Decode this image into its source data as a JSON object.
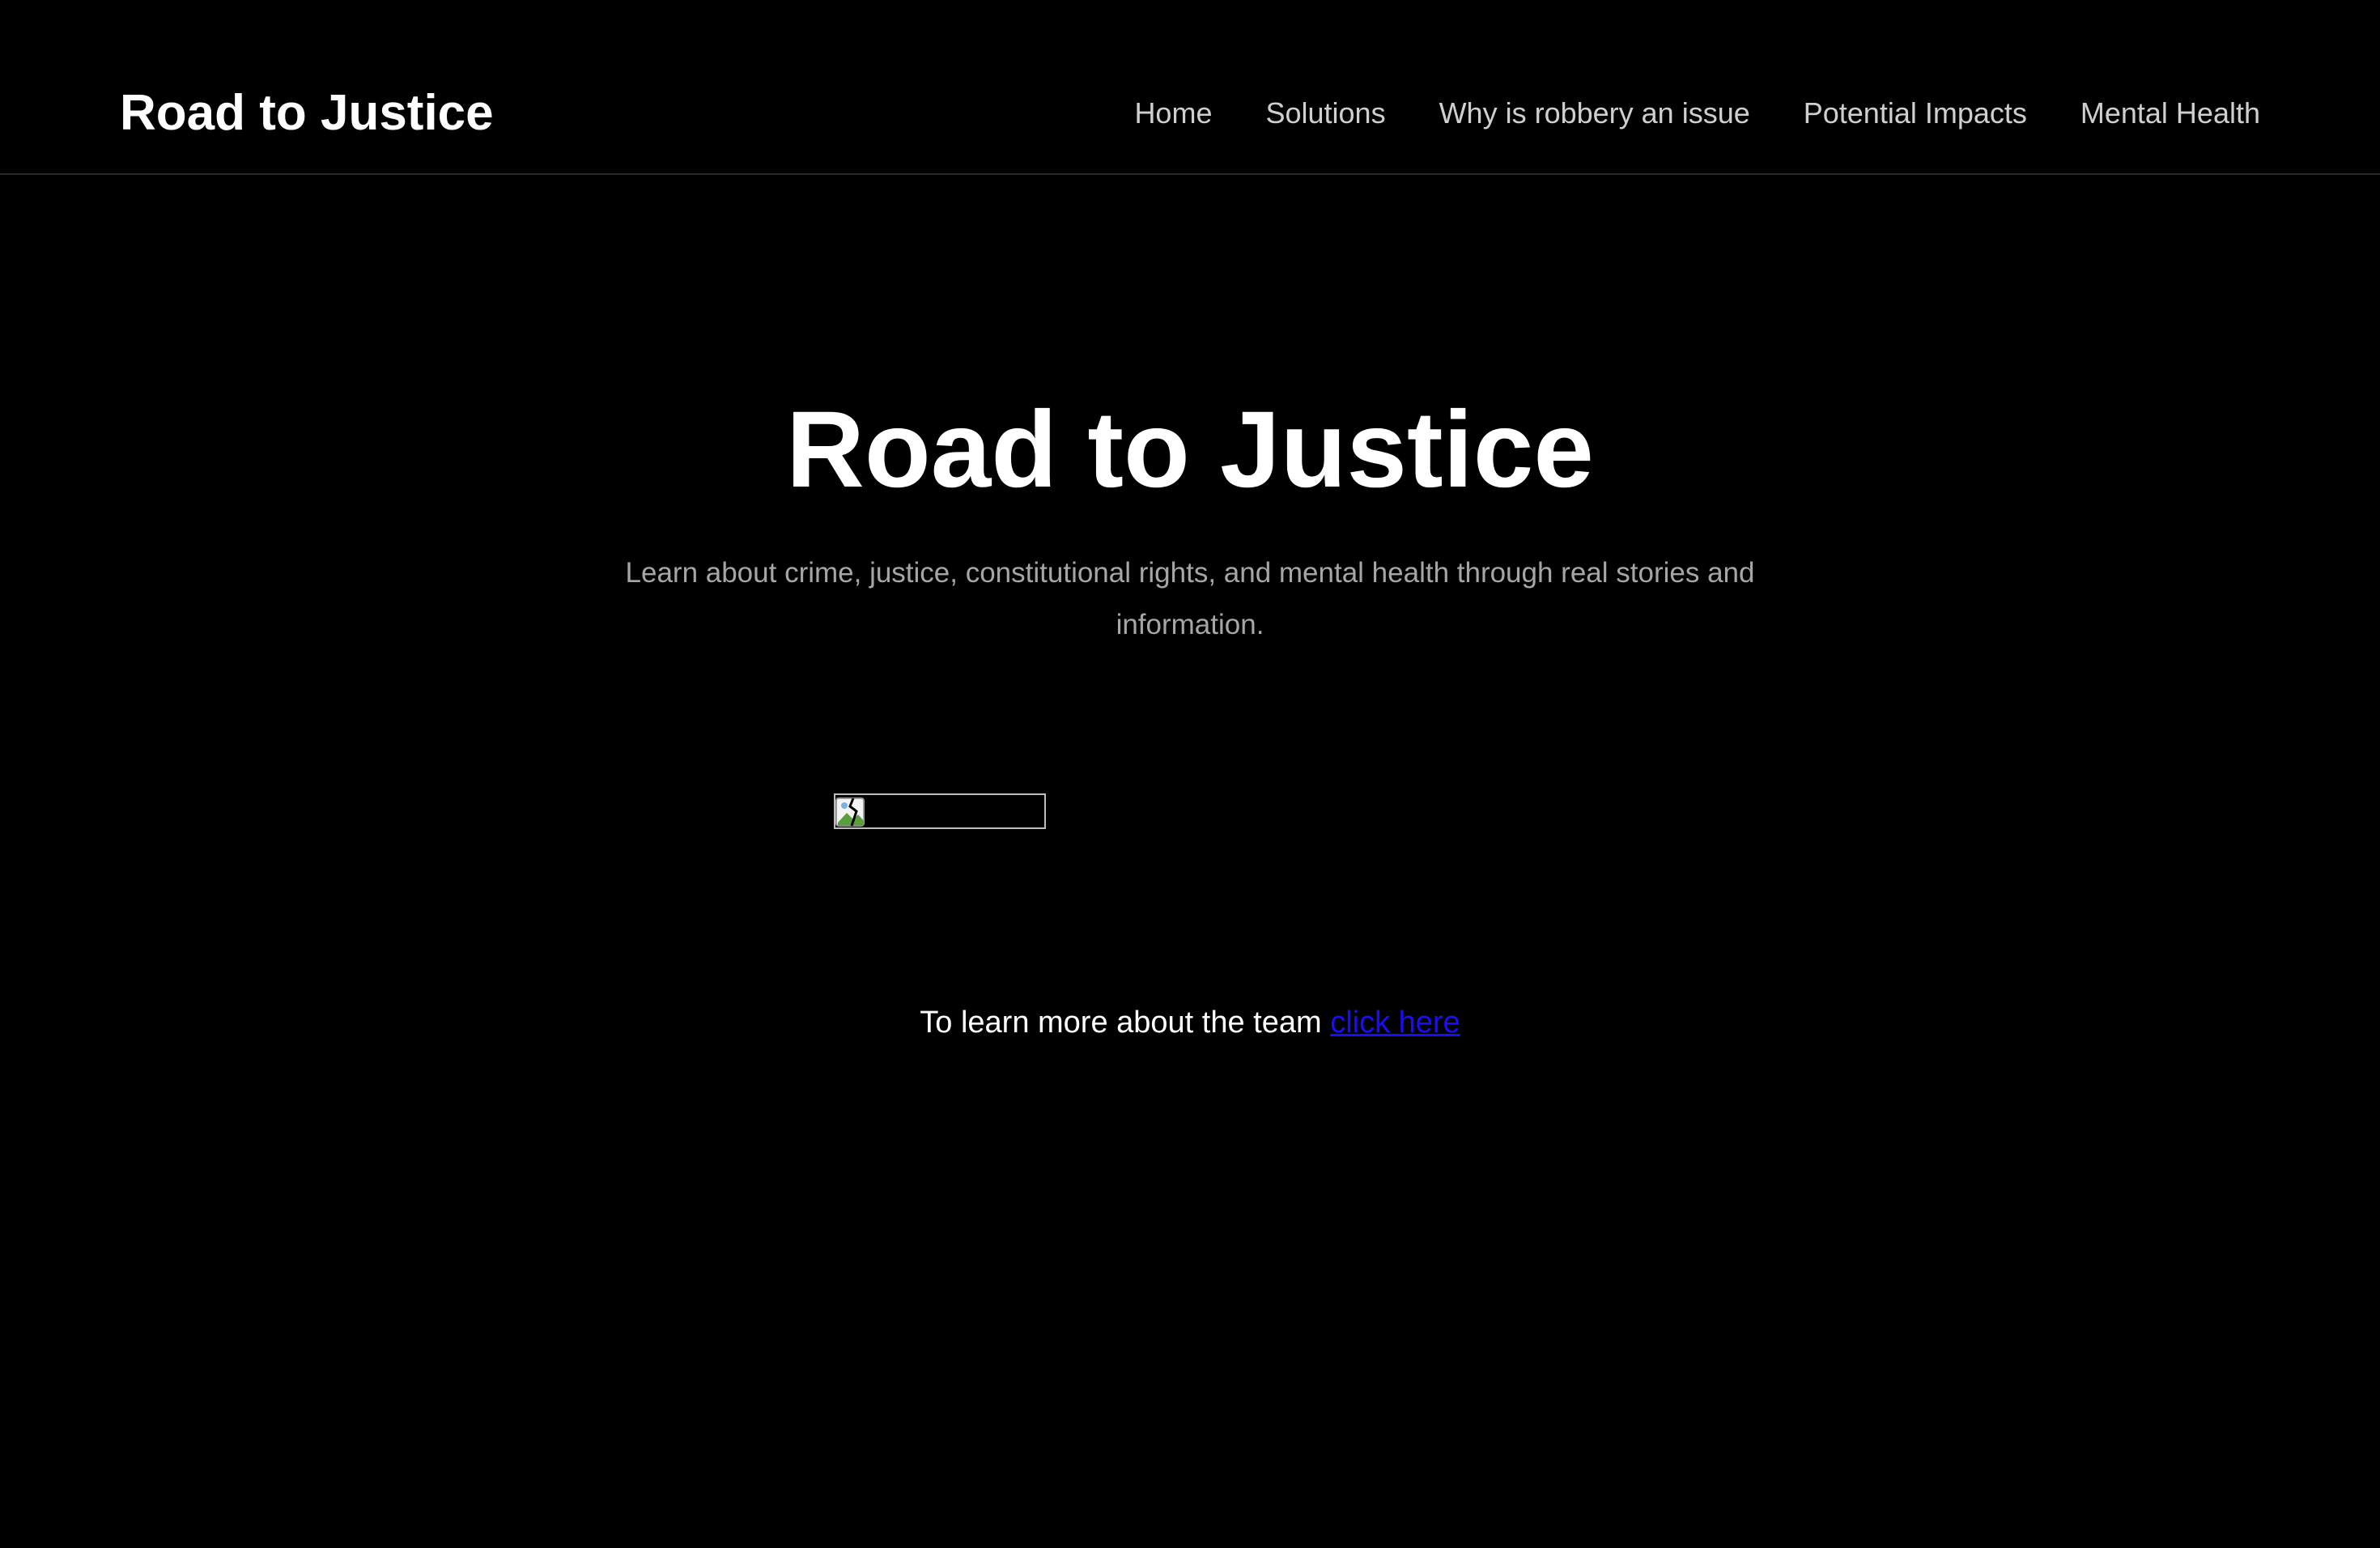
{
  "header": {
    "brand": "Road to Justice",
    "nav": [
      {
        "label": "Home"
      },
      {
        "label": "Solutions"
      },
      {
        "label": "Why is robbery an issue"
      },
      {
        "label": "Potential Impacts"
      },
      {
        "label": "Mental Health"
      }
    ]
  },
  "hero": {
    "title": "Road to Justice",
    "subtitle": "Learn about crime, justice, constitutional rights, and mental health through real stories and information."
  },
  "team": {
    "text": "To learn more about the team ",
    "link_label": "click here"
  },
  "icons": {
    "broken_image": "broken-image-icon"
  },
  "colors": {
    "background": "#000000",
    "text": "#ffffff",
    "muted_text": "#a6a6a6",
    "nav_text": "#cfcfcf",
    "link": "#1a0dff"
  }
}
